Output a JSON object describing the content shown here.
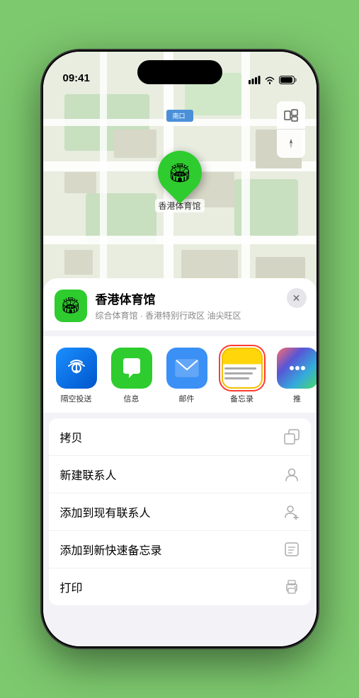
{
  "status_bar": {
    "time": "09:41",
    "location_icon": "▶",
    "signal_bars": "▐▐▐",
    "wifi": "WiFi",
    "battery": "Battery"
  },
  "map": {
    "location_label": "南口",
    "pin_label": "香港体育馆",
    "pin_emoji": "🏟",
    "map_icon": "🗺",
    "compass_icon": "⊳"
  },
  "place_card": {
    "icon": "🏟",
    "name": "香港体育馆",
    "subtitle": "综合体育馆 · 香港特别行政区 油尖旺区",
    "close": "✕"
  },
  "share_items": [
    {
      "id": "airdrop",
      "label": "隔空投送",
      "type": "airdrop"
    },
    {
      "id": "messages",
      "label": "信息",
      "type": "messages"
    },
    {
      "id": "mail",
      "label": "邮件",
      "type": "mail"
    },
    {
      "id": "notes",
      "label": "备忘录",
      "type": "notes",
      "selected": true
    },
    {
      "id": "more",
      "label": "推",
      "type": "more"
    }
  ],
  "actions": [
    {
      "label": "拷贝",
      "icon": "⧉"
    },
    {
      "label": "新建联系人",
      "icon": "👤"
    },
    {
      "label": "添加到现有联系人",
      "icon": "👤+"
    },
    {
      "label": "添加到新快速备忘录",
      "icon": "⊡"
    },
    {
      "label": "打印",
      "icon": "🖨"
    }
  ]
}
